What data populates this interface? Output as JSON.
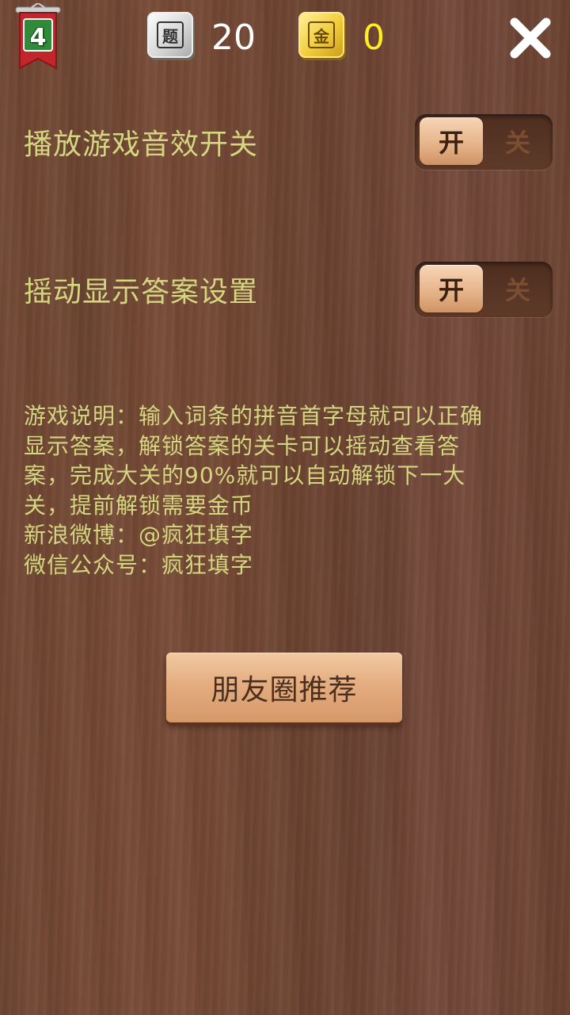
{
  "header": {
    "level_number": "4",
    "questions_icon_glyph": "题",
    "questions_count": "20",
    "coins_icon_glyph": "金",
    "coins_count": "0"
  },
  "settings": [
    {
      "label": "播放游戏音效开关",
      "on_label": "开",
      "off_label": "关",
      "state": "on"
    },
    {
      "label": "摇动显示答案设置",
      "on_label": "开",
      "off_label": "关",
      "state": "on"
    }
  ],
  "description_lines": [
    "游戏说明：输入词条的拼音首字母就可以正确",
    "显示答案，解锁答案的关卡可以摇动查看答",
    "案，完成大关的90%就可以自动解锁下一大",
    "关，提前解锁需要金币",
    "新浪微博：@疯狂填字",
    "微信公众号：疯狂填字"
  ],
  "share_button_label": "朋友圈推荐",
  "icons": {
    "level": "level-pennant-icon",
    "questions": "question-tile-icon",
    "coins": "gold-coin-tile-icon",
    "close": "close-icon"
  },
  "colors": {
    "label_text": "#d4d680",
    "coins_text": "#ffee22",
    "questions_text": "#ffffff"
  }
}
